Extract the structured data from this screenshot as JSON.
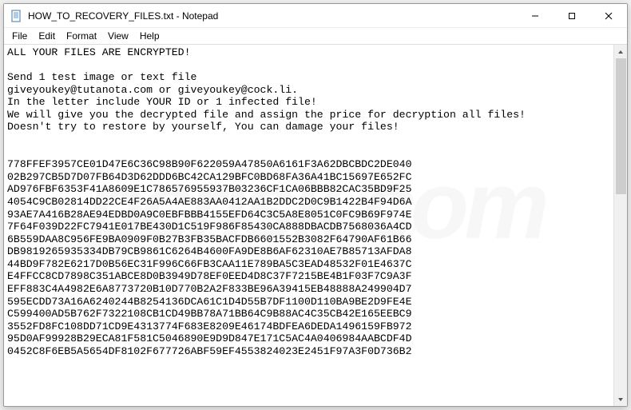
{
  "window": {
    "title": "HOW_TO_RECOVERY_FILES.txt - Notepad"
  },
  "menu": {
    "file": "File",
    "edit": "Edit",
    "format": "Format",
    "view": "View",
    "help": "Help"
  },
  "body_lines": [
    "ALL YOUR FILES ARE ENCRYPTED!",
    "",
    "Send 1 test image or text file",
    "giveyoukey@tutanota.com or giveyoukey@cock.li.",
    "In the letter include YOUR ID or 1 infected file!",
    "We will give you the decrypted file and assign the price for decryption all files!",
    "Doesn't try to restore by yourself, You can damage your files!",
    "",
    "",
    "778FFEF3957CE01D47E6C36C98B90F622059A47850A6161F3A62DBCBDC2DE040",
    "02B297CB5D7D07FB64D3D62DDD6BC42CA129BFC0BD68FA36A41BC15697E652FC",
    "AD976FBF6353F41A8609E1C786576955937B03236CF1CA06BBB82CAC35BD9F25",
    "4054C9CB02814DD22CE4F26A5A4AE883AA0412AA1B2DDC2D0C9B1422B4F94D6A",
    "93AE7A416B28AE94EDBD0A9C0EBFBBB4155EFD64C3C5A8E8051C0FC9B69F974E",
    "7F64F039D22FC7941E017BE430D1C519F986F85430CA888DBACDB7568036A4CD",
    "6B559DAA8C956FE9BA0909F0B27B3FB35BACFDB6601552B3082F64790AF61B66",
    "DB9819265935334DB79CB9861C6264B4600FA9DE8B6AF62310AE7B85713AFDA8",
    "44BD9F782E6217D0B56EC31F996C66FB3CAA11E789BA5C3EAD48532F01E4637C",
    "E4FFCC8CD7898C351ABCE8D0B3949D78EF0EED4D8C37F7215BE4B1F03F7C9A3F",
    "EFF883C4A4982E6A8773720B10D770B2A2F833BE96A39415EB48888A249904D7",
    "595ECDD73A16A6240244B8254136DCA61C1D4D55B7DF1100D110BA9BE2D9FE4E",
    "C599400AD5B762F7322108CB1CD49BB78A71BB64C9B88AC4C35CB42E165EEBC9",
    "3552FD8FC108DD71CD9E4313774F683E8209E46174BDFEA6DEDA1496159FB972",
    "95D0AF99928B29ECA81F581C5046890E9D9D847E171C5AC4A0406984AABCDF4D",
    "0452C8F6EB5A5654DF8102F677726ABF59EF4553824023E2451F97A3F0D736B2"
  ]
}
